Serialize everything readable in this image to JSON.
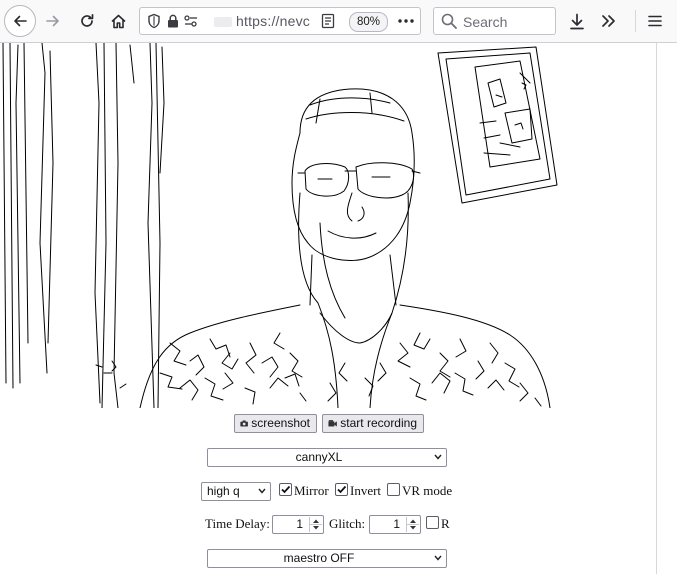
{
  "browser": {
    "url_text": "https://nevc",
    "zoom": "80%",
    "search_placeholder": "Search"
  },
  "controls": {
    "screenshot_label": "screenshot",
    "record_label": "start recording",
    "filter_select": "cannyXL",
    "quality_select": "high q",
    "mirror_label": "Mirror",
    "mirror_checked": true,
    "invert_label": "Invert",
    "invert_checked": true,
    "vr_label": "VR mode",
    "vr_checked": false,
    "time_delay_label": "Time Delay:",
    "time_delay_value": "1",
    "glitch_label": "Glitch:",
    "glitch_value": "1",
    "r_label": "R",
    "r_checked": false,
    "maestro_select": "maestro OFF"
  },
  "colors": {
    "toolbar_bg": "#f9f9fa",
    "button_bg": "#e9e9ed",
    "border": "#8f8f9d"
  }
}
